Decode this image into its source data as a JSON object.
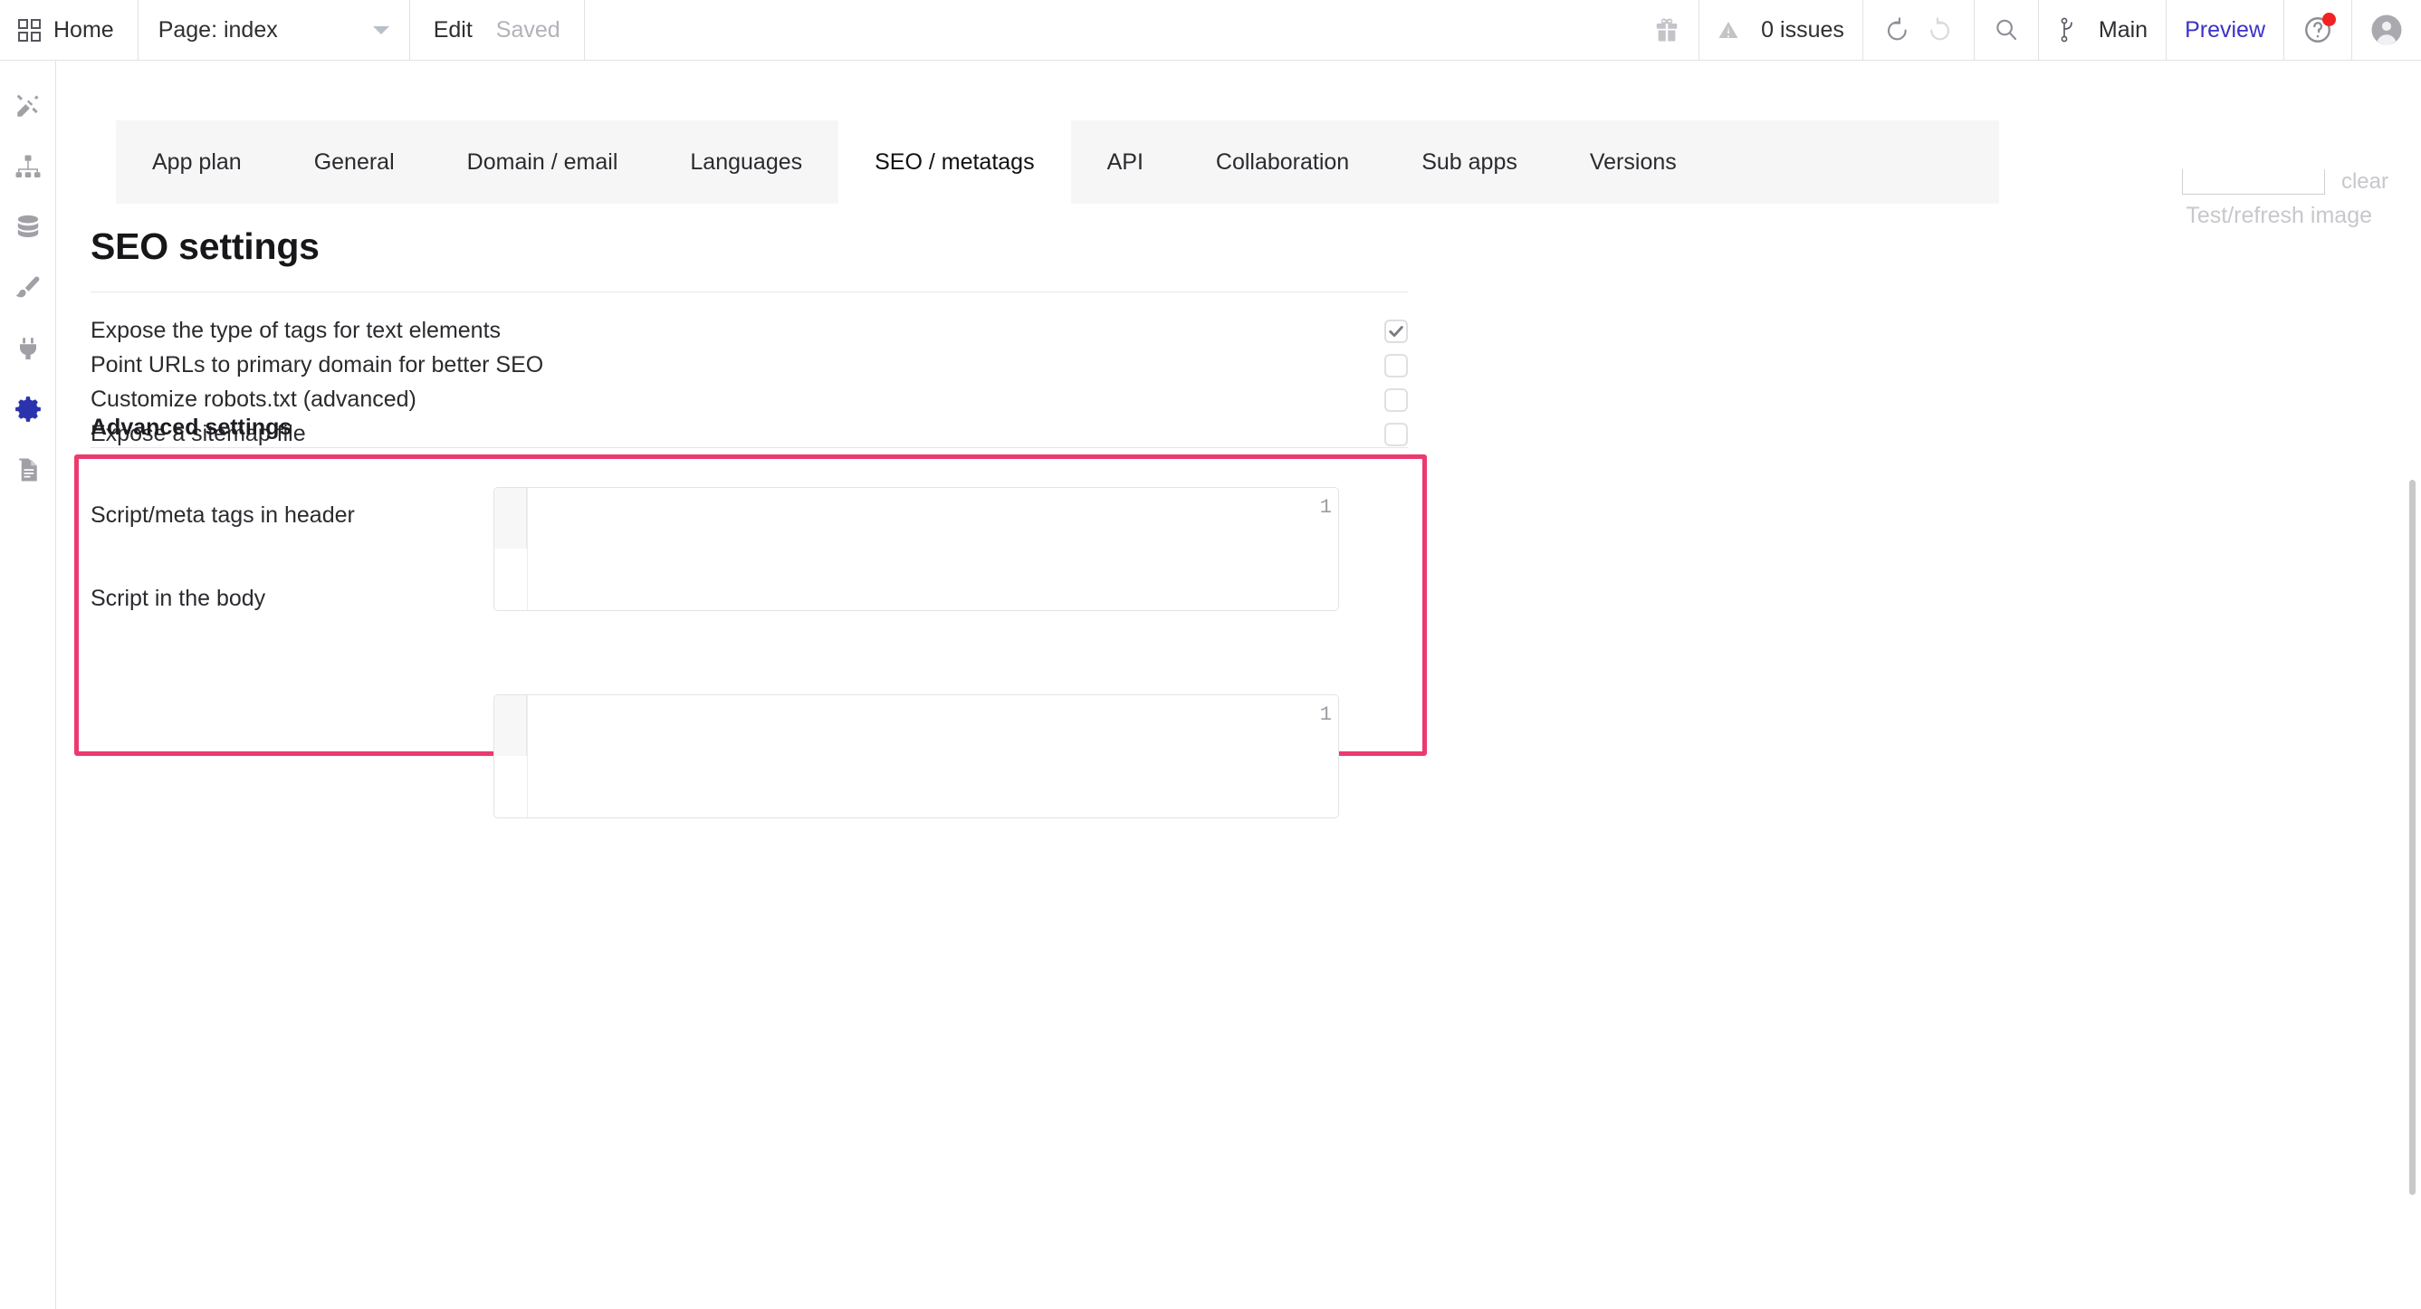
{
  "topbar": {
    "home_label": "Home",
    "home_icon": "grid-icon",
    "page_selector_label": "Page: index",
    "page_selector_caret": "chevron-down-icon",
    "edit_label": "Edit",
    "saved_label": "Saved",
    "gift_icon": "gift-icon",
    "warning_icon": "warning-triangle-icon",
    "issues_label": "0 issues",
    "undo_icon": "undo-icon",
    "redo_icon": "redo-icon",
    "search_icon": "search-icon",
    "branch_icon": "branch-icon",
    "branch_label": "Main",
    "preview_label": "Preview",
    "help_icon": "help-circle-icon",
    "help_badge": true,
    "avatar_icon": "user-avatar-icon"
  },
  "sidebar": {
    "items": [
      {
        "name": "design-tools",
        "icon": "pencil-ruler-icon",
        "active": false
      },
      {
        "name": "app-structure",
        "icon": "sitemap-icon",
        "active": false
      },
      {
        "name": "data",
        "icon": "database-icon",
        "active": false
      },
      {
        "name": "styles",
        "icon": "paintbrush-icon",
        "active": false
      },
      {
        "name": "plugins",
        "icon": "plug-icon",
        "active": false
      },
      {
        "name": "settings",
        "icon": "gear-icon",
        "active": true
      },
      {
        "name": "logs",
        "icon": "document-icon",
        "active": false
      }
    ],
    "active_color": "#2a33ad",
    "inactive_color": "#a0a0a6"
  },
  "tabs": [
    {
      "label": "App plan",
      "active": false
    },
    {
      "label": "General",
      "active": false
    },
    {
      "label": "Domain / email",
      "active": false
    },
    {
      "label": "Languages",
      "active": false
    },
    {
      "label": "SEO / metatags",
      "active": true
    },
    {
      "label": "API",
      "active": false
    },
    {
      "label": "Collaboration",
      "active": false
    },
    {
      "label": "Sub apps",
      "active": false
    },
    {
      "label": "Versions",
      "active": false
    }
  ],
  "top_right": {
    "input_value": "",
    "clear_label": "clear",
    "caption": "Test/refresh image"
  },
  "main": {
    "title": "SEO settings",
    "settings": [
      {
        "label": "Expose the type of tags for text elements",
        "checked": true
      },
      {
        "label": "Point URLs to primary domain for better SEO",
        "checked": false
      },
      {
        "label": "Customize robots.txt (advanced)",
        "checked": false
      },
      {
        "label": "Expose a sitemap file",
        "checked": false
      }
    ],
    "advanced_heading": "Advanced settings",
    "code_fields": [
      {
        "label": "Script/meta tags in header",
        "line_number": "1",
        "value": ""
      },
      {
        "label": "Script in the body",
        "line_number": "1",
        "value": ""
      }
    ],
    "highlight_color": "#ec3a6f"
  }
}
